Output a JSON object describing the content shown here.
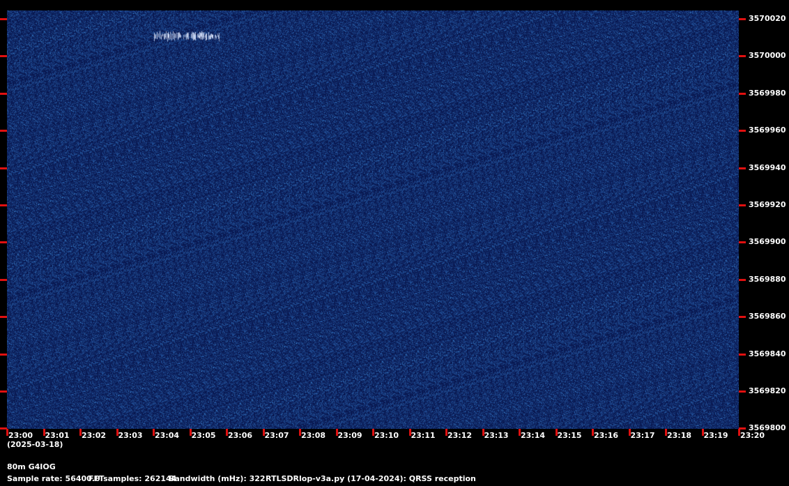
{
  "colors": {
    "background": "#000000",
    "waterfall_base": "#0a1a52",
    "tick": "#e01010",
    "text": "#ffffff",
    "signal": "#dde8ff"
  },
  "y_axis": {
    "labels": [
      "3570020",
      "3570000",
      "3569980",
      "3569960",
      "3569940",
      "3569920",
      "3569900",
      "3569880",
      "3569860",
      "3569840",
      "3569820",
      "3569800"
    ]
  },
  "x_axis": {
    "labels": [
      "23:00",
      "23:01",
      "23:02",
      "23:03",
      "23:04",
      "23:05",
      "23:06",
      "23:07",
      "23:08",
      "23:09",
      "23:10",
      "23:11",
      "23:12",
      "23:13",
      "23:14",
      "23:15",
      "23:16",
      "23:17",
      "23:18",
      "23:19",
      "23:20"
    ],
    "date": "(2025-03-18)"
  },
  "footer": {
    "station": "80m G4IOG",
    "sample_rate": "Sample rate: 56400.0",
    "fft_samples": "FFTsamples: 262144",
    "bandwidth": "Bandwidth (mHz): 322",
    "software": "RTLSDRlop-v3a.py (17-04-2024): QRSS reception"
  },
  "signal": {
    "start_time": "23:04",
    "end_time": "23:05.8",
    "frequency": 3570011
  }
}
